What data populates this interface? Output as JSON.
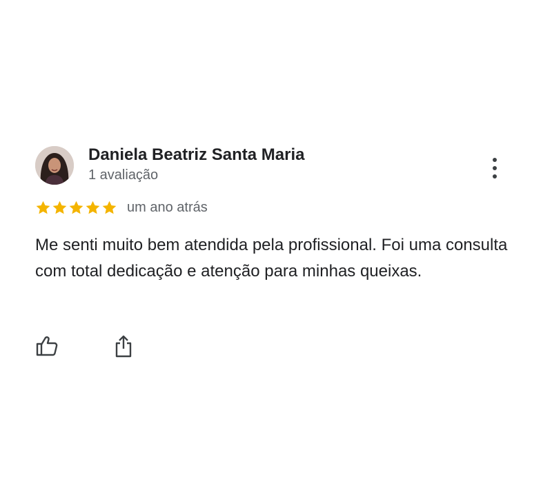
{
  "review": {
    "reviewer_name": "Daniela Beatriz Santa Maria",
    "review_count": "1 avaliação",
    "rating": 5,
    "rating_max": 5,
    "time": "um ano atrás",
    "text": "Me senti muito bem atendida pela profissional. Foi uma consulta com total dedicação e atenção para minhas queixas."
  },
  "icons": {
    "more": "more-vert-icon",
    "like": "thumbs-up-icon",
    "share": "share-icon",
    "star": "star-icon"
  },
  "colors": {
    "star": "#F4B400",
    "text": "#202124",
    "secondary": "#5F6368",
    "icon": "#3C4043"
  }
}
